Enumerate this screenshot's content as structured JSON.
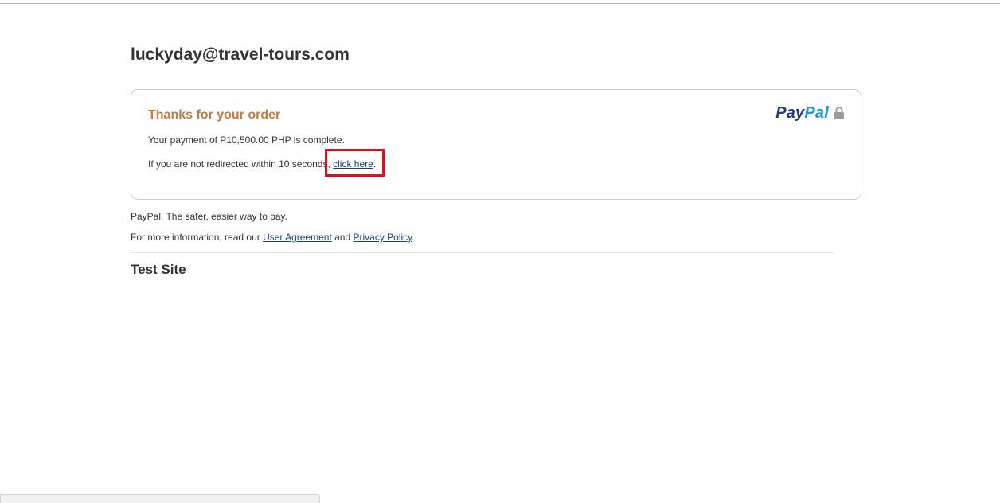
{
  "merchant": {
    "email": "luckyday@travel-tours.com"
  },
  "order": {
    "heading": "Thanks for your order",
    "payment_text": "Your payment of P10,500.00 PHP is complete.",
    "redirect_prefix": "If you are not redirected within 10 seconds, ",
    "redirect_link": "click here",
    "redirect_suffix": "."
  },
  "brand": {
    "logo_pay": "Pay",
    "logo_pal": "Pal",
    "logo_colors": {
      "pay": "#253b80",
      "pal": "#179bd7"
    },
    "icon": "lock-icon"
  },
  "footer": {
    "tagline": "PayPal. The safer, easier way to pay.",
    "info_prefix": "For more information, read our ",
    "user_agreement": "User Agreement",
    "info_and": " and ",
    "privacy_policy": "Privacy Policy",
    "info_suffix": ".",
    "site_name": "Test Site"
  },
  "colors": {
    "heading": "#c27b3d",
    "link": "#1a3d7c",
    "highlight": "#e0101e"
  }
}
